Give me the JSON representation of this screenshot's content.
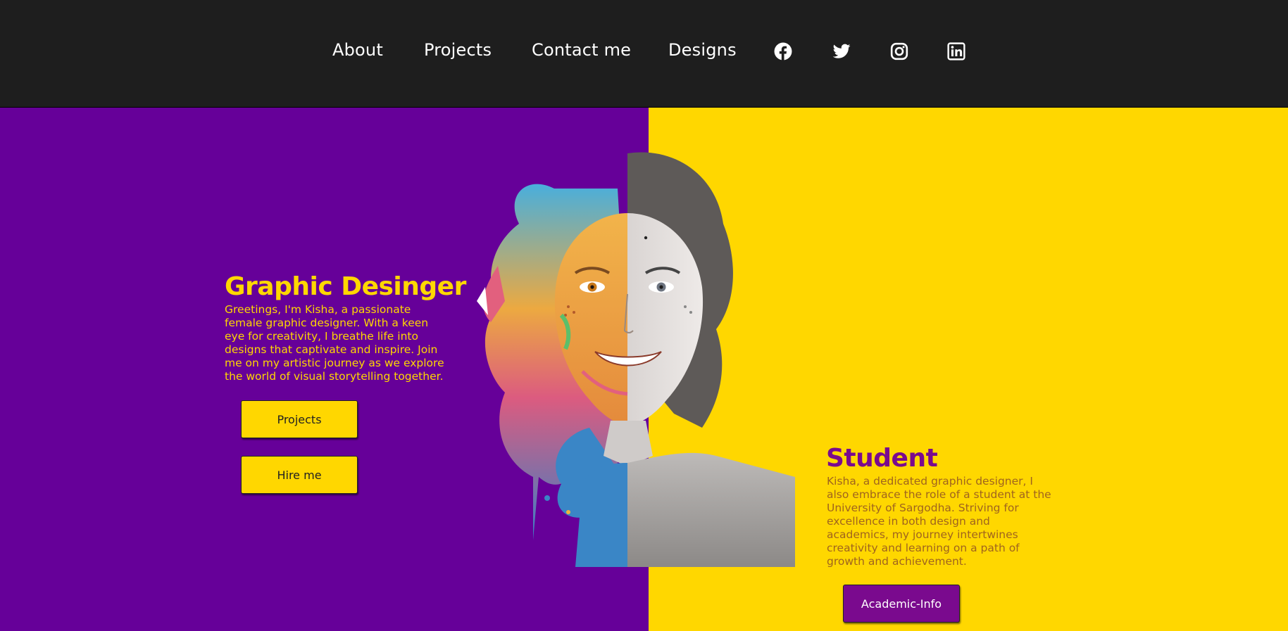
{
  "nav": {
    "links": [
      "About",
      "Projects",
      "Contact me",
      "Designs"
    ],
    "social_icons": [
      "facebook-icon",
      "twitter-icon",
      "instagram-icon",
      "linkedin-icon"
    ]
  },
  "hero_left": {
    "title": "Graphic Desinger",
    "description": "Greetings, I'm Kisha, a passionate female graphic designer. With a keen eye for creativity, I breathe life into designs that captivate and inspire. Join me on my artistic journey as we explore the world of visual storytelling together.",
    "buttons": [
      "Projects",
      "Hire me"
    ]
  },
  "hero_right": {
    "title": "Student",
    "description": "Kisha, a dedicated graphic designer, I also embrace the role of a student at the University of Sargodha. Striving for excellence in both design and academics, my journey intertwines creativity and learning on a path of growth and achievement.",
    "button": "Academic-Info"
  },
  "colors": {
    "nav_bg": "#1e1e1e",
    "purple": "#660099",
    "yellow": "#ffd700",
    "button_purple": "#7a0a8e"
  }
}
